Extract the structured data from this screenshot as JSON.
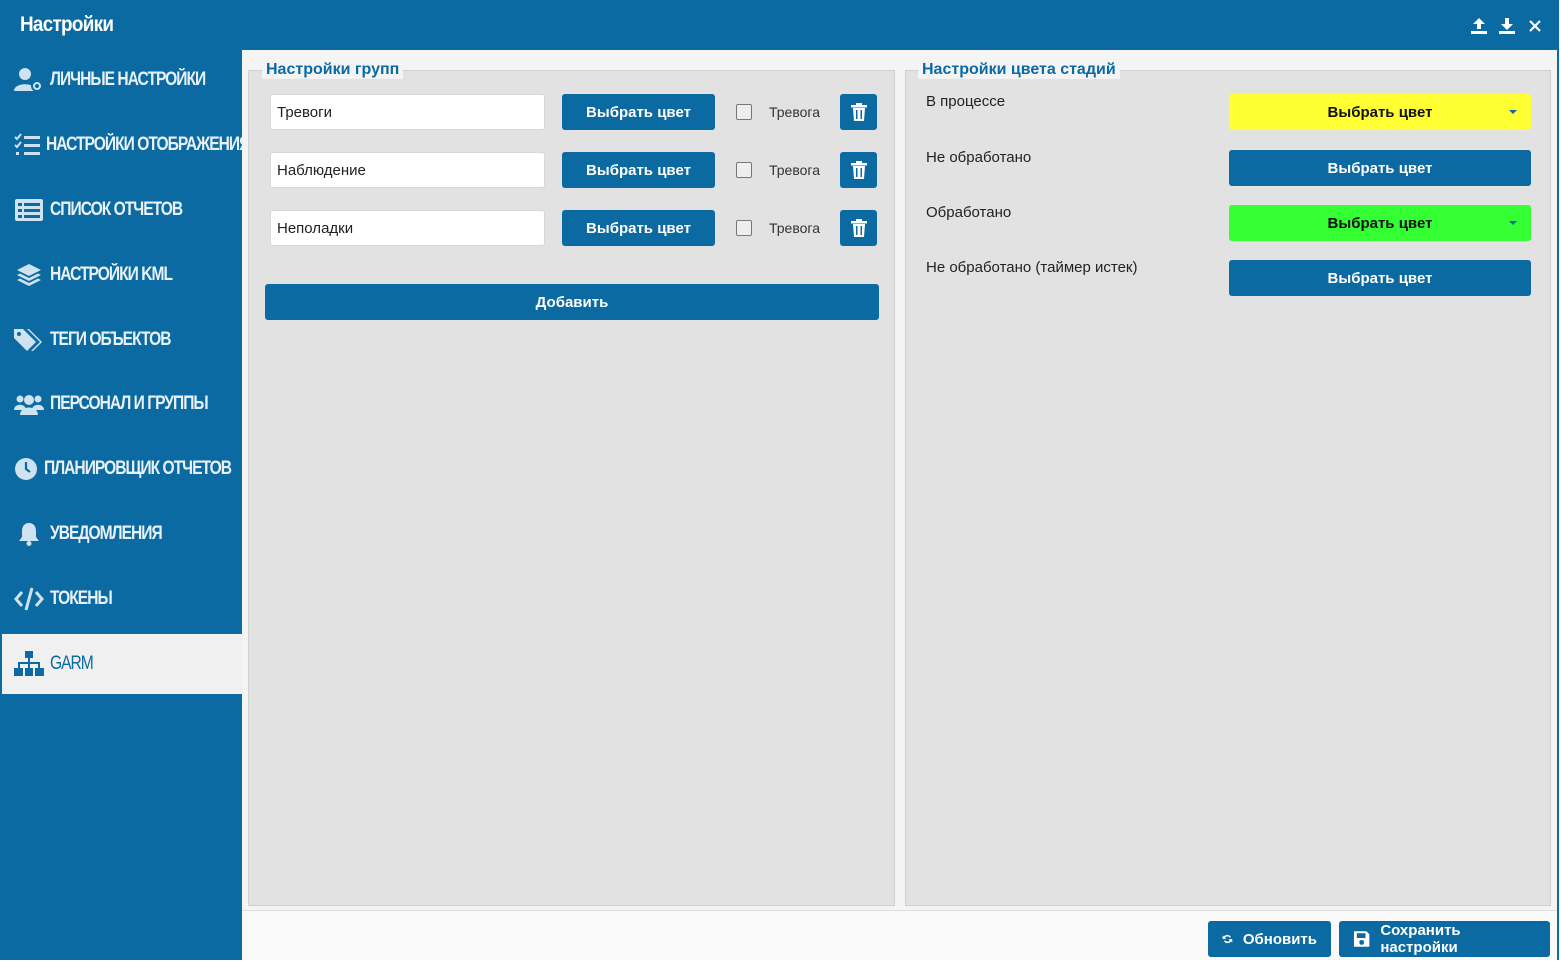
{
  "window": {
    "title": "Настройки"
  },
  "colors": {
    "primary": "#0a6aa1",
    "yellow": "#ffff33",
    "green": "#33ff33",
    "panel_bg": "#e2e2e2"
  },
  "titlebar_icons": [
    "upload-icon",
    "download-icon",
    "close-icon"
  ],
  "sidebar": {
    "items": [
      {
        "label": "ЛИЧНЫЕ НАСТРОЙКИ",
        "icon": "user-gear-icon"
      },
      {
        "label": "НАСТРОЙКИ ОТОБРАЖЕНИЯ",
        "icon": "list-check-icon"
      },
      {
        "label": "СПИСОК ОТЧЕТОВ",
        "icon": "list-alt-icon"
      },
      {
        "label": "НАСТРОЙКИ KML",
        "icon": "layers-icon"
      },
      {
        "label": "ТЕГИ ОБЪЕКТОВ",
        "icon": "tags-icon"
      },
      {
        "label": "ПЕРСОНАЛ И ГРУППЫ",
        "icon": "users-icon"
      },
      {
        "label": "ПЛАНИРОВЩИК ОТЧЕТОВ",
        "icon": "clock-icon"
      },
      {
        "label": "УВЕДОМЛЕНИЯ",
        "icon": "bell-icon"
      },
      {
        "label": "ТОКЕНЫ",
        "icon": "code-icon"
      },
      {
        "label": "GARM",
        "icon": "sitemap-icon",
        "active": true
      }
    ]
  },
  "groups": {
    "legend": "Настройки групп",
    "rows": [
      {
        "name": "Тревоги",
        "pick_label": "Выбрать цвет",
        "alarm_label": "Тревога",
        "alarm_checked": false
      },
      {
        "name": "Наблюдение",
        "pick_label": "Выбрать цвет",
        "alarm_label": "Тревога",
        "alarm_checked": false
      },
      {
        "name": "Неполадки",
        "pick_label": "Выбрать цвет",
        "alarm_label": "Тревога",
        "alarm_checked": false
      }
    ],
    "add_label": "Добавить"
  },
  "stages": {
    "legend": "Настройки цвета стадий",
    "rows": [
      {
        "label": "В процессе",
        "button_label": "Выбрать цвет",
        "color": "#ffff33",
        "has_dropdown": true
      },
      {
        "label": "Не обработано",
        "button_label": "Выбрать цвет",
        "color": null,
        "has_dropdown": false
      },
      {
        "label": "Обработано",
        "button_label": "Выбрать цвет",
        "color": "#33ff33",
        "has_dropdown": true
      },
      {
        "label": "Не обработано (таймер истек)",
        "button_label": "Выбрать цвет",
        "color": null,
        "has_dropdown": false
      }
    ]
  },
  "footer": {
    "refresh_label": "Обновить",
    "save_label": "Сохранить настройки"
  }
}
